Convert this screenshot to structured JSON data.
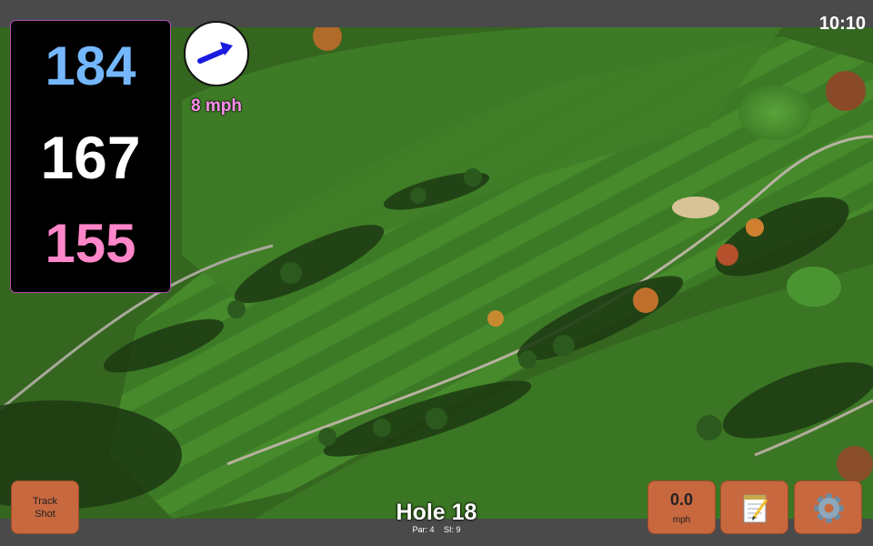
{
  "status_bar": {
    "time": "10:10"
  },
  "distances": {
    "back": "184",
    "center": "167",
    "front": "155"
  },
  "wind": {
    "speed_label": "8 mph",
    "direction_icon": "arrow-icon"
  },
  "hole": {
    "title": "Hole 18",
    "par": "Par: 4",
    "stroke_index": "SI: 9"
  },
  "buttons": {
    "track_shot": "Track\nShot",
    "speed_value": "0.0",
    "speed_unit": "mph",
    "notes_icon": "notepad-icon",
    "settings_icon": "gear-icon"
  },
  "colors": {
    "back_distance": "#74b7ff",
    "center_distance": "#ffffff",
    "front_distance": "#ff86c9",
    "wind_text": "#ff8cf0",
    "button": "#c8683e"
  }
}
